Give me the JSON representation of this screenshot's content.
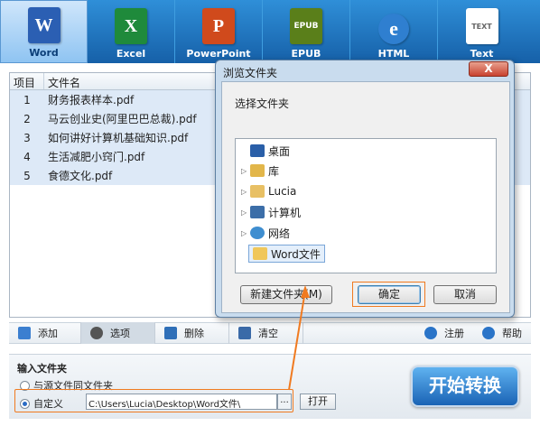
{
  "tabs": [
    {
      "label": "Word",
      "glyph": "W",
      "color": "#2b5fb3"
    },
    {
      "label": "Excel",
      "glyph": "X",
      "color": "#1f8a3b"
    },
    {
      "label": "PowerPoint",
      "glyph": "P",
      "color": "#d04a1c"
    },
    {
      "label": "EPUB",
      "glyph": "EPUB",
      "color": "#5a7f1a"
    },
    {
      "label": "HTML",
      "glyph": "e",
      "color": "#2f7fd0"
    },
    {
      "label": "Text",
      "glyph": "TEXT",
      "color": "#ffffff"
    }
  ],
  "file_list": {
    "col_index": "项目",
    "col_name": "文件名",
    "rows": [
      {
        "index": "1",
        "name": "财务报表样本.pdf"
      },
      {
        "index": "2",
        "name": "马云创业史(阿里巴巴总裁).pdf"
      },
      {
        "index": "3",
        "name": "如何讲好计算机基础知识.pdf"
      },
      {
        "index": "4",
        "name": "生活减肥小窍门.pdf"
      },
      {
        "index": "5",
        "name": "食德文化.pdf"
      }
    ]
  },
  "toolbar": {
    "add": "添加",
    "options": "选项",
    "delete": "删除",
    "clear": "清空",
    "register": "注册",
    "help": "帮助"
  },
  "output": {
    "title": "输入文件夹",
    "same_as_source": "与源文件同文件夹",
    "custom": "自定义",
    "path": "C:\\Users\\Lucia\\Desktop\\Word文件\\",
    "browse": "...",
    "open": "打开",
    "start": "开始转换"
  },
  "dialog": {
    "title": "浏览文件夹",
    "close": "X",
    "prompt": "选择文件夹",
    "tree": [
      "桌面",
      "库",
      "Lucia",
      "计算机",
      "网络",
      "Word文件"
    ],
    "new_folder": "新建文件夹(M)",
    "ok": "确定",
    "cancel": "取消"
  }
}
